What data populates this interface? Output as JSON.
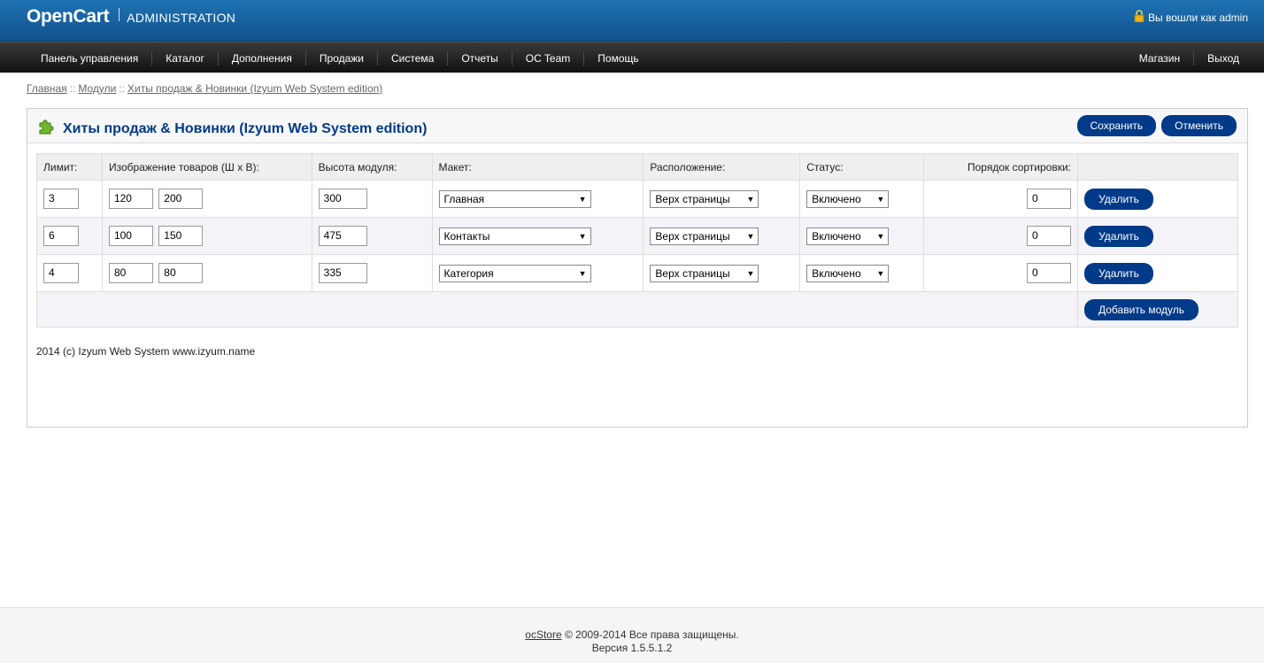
{
  "header": {
    "brand": "OpenCart",
    "subtitle": "ADMINISTRATION",
    "login_text": "Вы вошли как admin"
  },
  "menu": {
    "left": [
      "Панель управления",
      "Каталог",
      "Дополнения",
      "Продажи",
      "Система",
      "Отчеты",
      "OC Team",
      "Помощь"
    ],
    "right": [
      "Магазин",
      "Выход"
    ]
  },
  "breadcrumb": [
    "Главная",
    "Модули",
    "Хиты продаж & Новинки (Izyum Web System edition)"
  ],
  "page": {
    "title": "Хиты продаж & Новинки (Izyum Web System edition)",
    "save_label": "Сохранить",
    "cancel_label": "Отменить"
  },
  "table": {
    "headers": [
      "Лимит:",
      "Изображение товаров (Ш x В):",
      "Высота модуля:",
      "Макет:",
      "Расположение:",
      "Статус:",
      "Порядок сортировки:",
      ""
    ],
    "rows": [
      {
        "limit": "3",
        "width": "120",
        "height": "200",
        "module_height": "300",
        "layout": "Главная",
        "position": "Верх страницы",
        "status": "Включено",
        "sort": "0"
      },
      {
        "limit": "6",
        "width": "100",
        "height": "150",
        "module_height": "475",
        "layout": "Контакты",
        "position": "Верх страницы",
        "status": "Включено",
        "sort": "0"
      },
      {
        "limit": "4",
        "width": "80",
        "height": "80",
        "module_height": "335",
        "layout": "Категория",
        "position": "Верх страницы",
        "status": "Включено",
        "sort": "0"
      }
    ],
    "remove_label": "Удалить",
    "add_label": "Добавить модуль"
  },
  "module_copyright": "2014 (c) Izyum Web System www.izyum.name",
  "footer": {
    "link": "ocStore",
    "rights": " © 2009-2014 Все права защищены.",
    "version": "Версия 1.5.5.1.2"
  },
  "colors": {
    "header": "#10538c",
    "button": "#003a88",
    "title": "#003a88"
  }
}
